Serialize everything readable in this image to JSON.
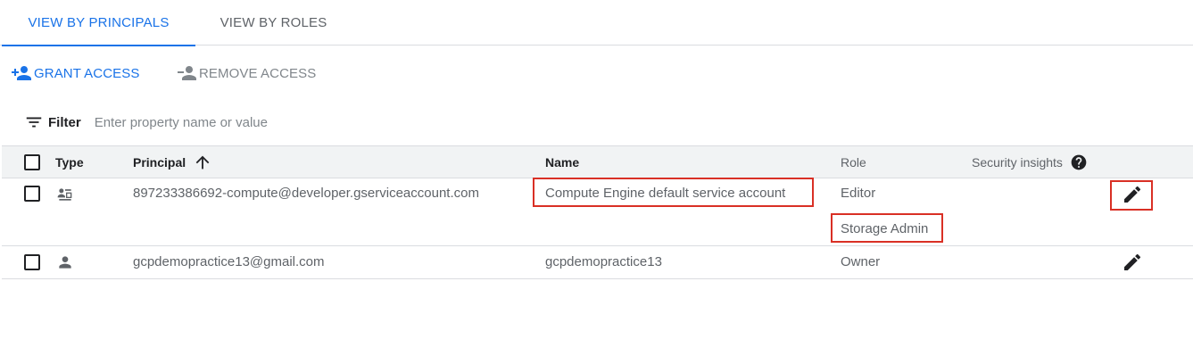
{
  "tabs": [
    {
      "label": "VIEW BY PRINCIPALS",
      "active": true
    },
    {
      "label": "VIEW BY ROLES",
      "active": false
    }
  ],
  "actions": {
    "grant": "GRANT ACCESS",
    "remove": "REMOVE ACCESS"
  },
  "filter": {
    "label": "Filter",
    "placeholder": "Enter property name or value"
  },
  "table": {
    "headers": {
      "type": "Type",
      "principal": "Principal",
      "name": "Name",
      "role": "Role",
      "security": "Security insights"
    },
    "rows": [
      {
        "type_icon": "service-account-icon",
        "principal": "897233386692-compute@developer.gserviceaccount.com",
        "name": "Compute Engine default service account",
        "roles": [
          "Editor",
          "Storage Admin"
        ]
      },
      {
        "type_icon": "person-icon",
        "principal": "gcpdemopractice13@gmail.com",
        "name": "gcpdemopractice13",
        "roles": [
          "Owner"
        ]
      }
    ]
  },
  "colors": {
    "accent": "#1a73e8",
    "highlight": "#d93025",
    "header_bg": "#f1f3f4"
  }
}
